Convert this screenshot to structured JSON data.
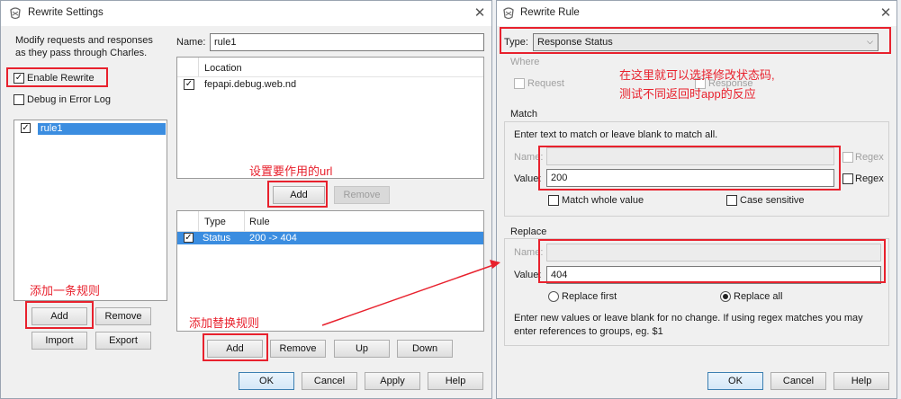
{
  "left_window": {
    "title": "Rewrite Settings",
    "description_line1": "Modify requests and responses",
    "description_line2": "as they pass through Charles.",
    "enable_rewrite": "Enable Rewrite",
    "debug_error_log": "Debug in Error Log",
    "sets": [
      "rule1"
    ],
    "name_label": "Name:",
    "name_value": "rule1",
    "location_header": "Location",
    "locations": [
      "fepapi.debug.web.nd"
    ],
    "location_add": "Add",
    "location_remove": "Remove",
    "rules_headers": {
      "type": "Type",
      "rule": "Rule"
    },
    "rules": [
      {
        "type": "Status",
        "rule": "200 -> 404"
      }
    ],
    "set_add": "Add",
    "set_remove": "Remove",
    "import": "Import",
    "export": "Export",
    "rule_add": "Add",
    "rule_remove": "Remove",
    "rule_up": "Up",
    "rule_down": "Down",
    "ok": "OK",
    "cancel": "Cancel",
    "apply": "Apply",
    "help": "Help"
  },
  "right_window": {
    "title": "Rewrite Rule",
    "type_label": "Type:",
    "type_value": "Response Status",
    "where_label": "Where",
    "where_request": "Request",
    "where_response": "Response",
    "match_title": "Match",
    "match_hint": "Enter text to match or leave blank to match all.",
    "match_name_label": "Name:",
    "match_value_label": "Value:",
    "match_value": "200",
    "regex": "Regex",
    "match_whole_value": "Match whole value",
    "case_sensitive": "Case sensitive",
    "replace_title": "Replace",
    "replace_name_label": "Name:",
    "replace_value_label": "Value:",
    "replace_value": "404",
    "replace_first": "Replace first",
    "replace_all": "Replace all",
    "replace_hint_line1": "Enter new values or leave blank for no change. If using regex matches you may",
    "replace_hint_line2": "enter references to groups, eg. $1",
    "ok": "OK",
    "cancel": "Cancel",
    "help": "Help"
  },
  "annotations": {
    "type_note_line1": "在这里就可以选择修改状态码,",
    "type_note_line2": "测试不同返回时app的反应",
    "url_note": "设置要作用的url",
    "add_rule_note": "添加一条规则",
    "add_replace_note": "添加替换规则"
  },
  "colors": {
    "annotation_red": "#e8212d",
    "selection_blue": "#3b8de0"
  }
}
